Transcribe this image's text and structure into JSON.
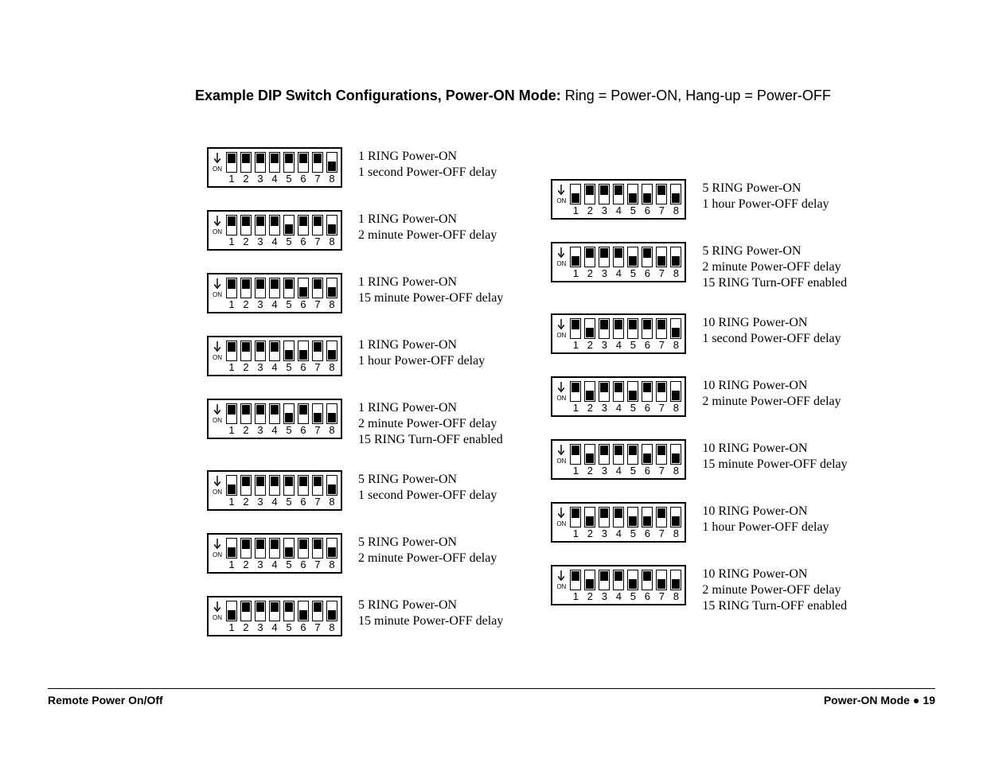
{
  "heading": {
    "bold": "Example DIP Switch Configurations, Power-ON Mode:",
    "rest": "  Ring = Power-ON, Hang-up = Power-OFF"
  },
  "dip_label_on": "ON",
  "dip_numbers": [
    "1",
    "2",
    "3",
    "4",
    "5",
    "6",
    "7",
    "8"
  ],
  "left": [
    {
      "sw": [
        1,
        1,
        1,
        1,
        1,
        1,
        1,
        0
      ],
      "lines": [
        "1 RING Power-ON",
        "1 second Power-OFF delay"
      ]
    },
    {
      "sw": [
        1,
        1,
        1,
        1,
        0,
        1,
        1,
        0
      ],
      "lines": [
        "1 RING Power-ON",
        "2 minute Power-OFF delay"
      ]
    },
    {
      "sw": [
        1,
        1,
        1,
        1,
        1,
        0,
        1,
        0
      ],
      "lines": [
        "1 RING Power-ON",
        "15 minute Power-OFF delay"
      ]
    },
    {
      "sw": [
        1,
        1,
        1,
        1,
        0,
        0,
        1,
        0
      ],
      "lines": [
        "1 RING Power-ON",
        "1 hour Power-OFF delay"
      ]
    },
    {
      "sw": [
        1,
        1,
        1,
        1,
        0,
        1,
        0,
        0
      ],
      "lines": [
        "1 RING Power-ON",
        "2 minute Power-OFF delay",
        "15 RING Turn-OFF enabled"
      ]
    },
    {
      "sw": [
        0,
        1,
        1,
        1,
        1,
        1,
        1,
        0
      ],
      "lines": [
        "5 RING Power-ON",
        "1 second Power-OFF delay"
      ]
    },
    {
      "sw": [
        0,
        1,
        1,
        1,
        0,
        1,
        1,
        0
      ],
      "lines": [
        "5 RING Power-ON",
        "2 minute Power-OFF delay"
      ]
    },
    {
      "sw": [
        0,
        1,
        1,
        1,
        1,
        0,
        1,
        0
      ],
      "lines": [
        "5 RING Power-ON",
        "15 minute Power-OFF delay"
      ]
    }
  ],
  "right": [
    {
      "sw": [
        0,
        1,
        1,
        1,
        0,
        0,
        1,
        0
      ],
      "lines": [
        "5 RING Power-ON",
        "1 hour Power-OFF delay"
      ]
    },
    {
      "sw": [
        0,
        1,
        1,
        1,
        0,
        1,
        0,
        0
      ],
      "lines": [
        "5 RING Power-ON",
        "2 minute Power-OFF delay",
        "15 RING Turn-OFF enabled"
      ]
    },
    {
      "sw": [
        1,
        0,
        1,
        1,
        1,
        1,
        1,
        0
      ],
      "lines": [
        "10 RING Power-ON",
        "1 second Power-OFF delay"
      ]
    },
    {
      "sw": [
        1,
        0,
        1,
        1,
        0,
        1,
        1,
        0
      ],
      "lines": [
        "10 RING Power-ON",
        "2 minute Power-OFF delay"
      ]
    },
    {
      "sw": [
        1,
        0,
        1,
        1,
        1,
        0,
        1,
        0
      ],
      "lines": [
        "10 RING Power-ON",
        "15 minute Power-OFF delay"
      ]
    },
    {
      "sw": [
        1,
        0,
        1,
        1,
        0,
        0,
        1,
        0
      ],
      "lines": [
        "10 RING Power-ON",
        "1 hour Power-OFF delay"
      ]
    },
    {
      "sw": [
        1,
        0,
        1,
        1,
        0,
        1,
        0,
        0
      ],
      "lines": [
        "10 RING Power-ON",
        "2 minute Power-OFF delay",
        "15 RING Turn-OFF enabled"
      ]
    }
  ],
  "footer": {
    "left": "Remote Power On/Off",
    "section": "Power-ON Mode",
    "dot": "●",
    "page": "19"
  }
}
